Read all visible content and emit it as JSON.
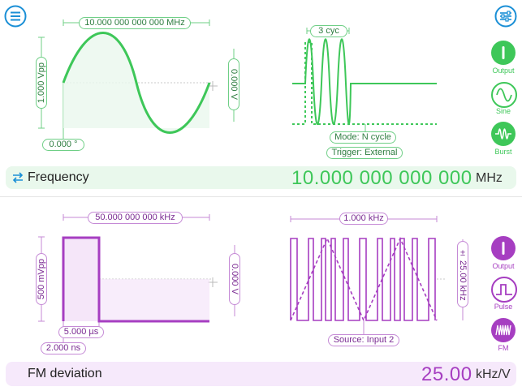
{
  "colors": {
    "green": "#3ec759",
    "purple": "#a63ec1",
    "blue": "#1a8fd6",
    "green_bar": "#e9f8ec",
    "purple_bar": "#f6e9fb"
  },
  "header": {
    "menu_icon": "hamburger-menu-icon",
    "settings_icon": "sliders-icon"
  },
  "channel1": {
    "frequency_label": "10.000 000 000 000 MHz",
    "amplitude_label": "1.000 Vpp",
    "offset_label": "0.000 V",
    "phase_label": "0.000 °",
    "burst_cycles_label": "3 cyc",
    "mode_label": "Mode: N cycle",
    "trigger_label": "Trigger: External",
    "side": {
      "output_label": "Output",
      "waveform_label": "Sine",
      "modulation_label": "Burst"
    },
    "param": {
      "name": "Frequency",
      "value": "10.000 000 000 000",
      "unit": "MHz"
    }
  },
  "channel2": {
    "frequency_label": "50.000 000 000 kHz",
    "amplitude_label": "500 mVpp",
    "offset_label": "0.000 V",
    "width_label": "5.000 µs",
    "edge_label": "2.000 ns",
    "mod_freq_label": "1.000 kHz",
    "deviation_label": "± 25.00 kHz",
    "source_label": "Source: Input 2",
    "side": {
      "output_label": "Output",
      "waveform_label": "Pulse",
      "modulation_label": "FM"
    },
    "param": {
      "name": "FM deviation",
      "value": "25.00",
      "unit": "kHz/V"
    }
  }
}
